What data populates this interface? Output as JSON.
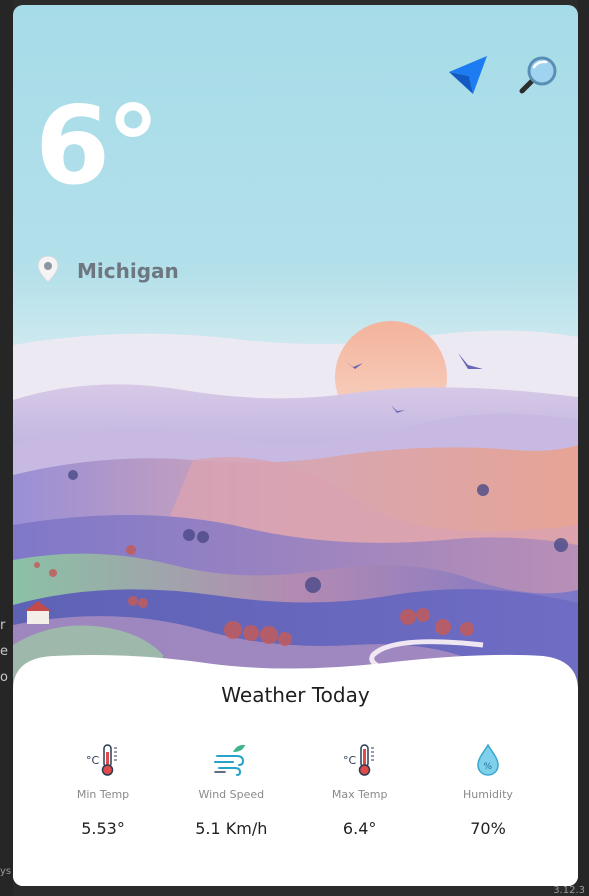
{
  "app": {
    "temperature": "6°",
    "location": "Michigan"
  },
  "icons": {
    "navigate": "navigation-arrow-icon",
    "search": "magnifier-icon",
    "location_pin": "location-pin-icon"
  },
  "colors": {
    "accent": "#1e7cf2",
    "sky": "#a6dce8",
    "card": "#ffffff",
    "temp_text": "#ffffff",
    "location_text": "#6e7780"
  },
  "card": {
    "title": "Weather Today",
    "stats": [
      {
        "label": "Min Temp",
        "value": "5.53°",
        "icon": "thermometer-icon"
      },
      {
        "label": "Wind Speed",
        "value": "5.1 Km/h",
        "icon": "wind-icon"
      },
      {
        "label": "Max Temp",
        "value": "6.4°",
        "icon": "thermometer-icon"
      },
      {
        "label": "Humidity",
        "value": "70%",
        "icon": "humidity-drop-icon"
      }
    ]
  },
  "background": {
    "fragments": [
      "r",
      "e",
      "o"
    ],
    "bottom_left": "ys",
    "bottom_right": "3.12.3"
  }
}
